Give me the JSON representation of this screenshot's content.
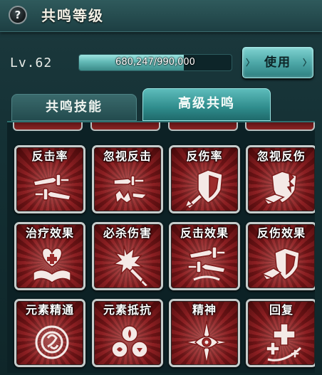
{
  "header": {
    "help_symbol": "?",
    "title": "共鸣等级"
  },
  "level": {
    "label": "Lv.62",
    "progress_text": "680,247/990,000",
    "progress_fraction": 0.687
  },
  "use_button": {
    "label": "使用",
    "left_arrow": "〉",
    "right_arrow": "〉"
  },
  "tabs": [
    {
      "label": "共鸣技能",
      "active": false
    },
    {
      "label": "高级共鸣",
      "active": true
    }
  ],
  "cards": [
    {
      "label": "反击率",
      "icon": "counter-rate-icon"
    },
    {
      "label": "忽视反击",
      "icon": "ignore-counter-icon"
    },
    {
      "label": "反伤率",
      "icon": "reflect-rate-icon"
    },
    {
      "label": "忽视反伤",
      "icon": "ignore-reflect-icon"
    },
    {
      "label": "治疗效果",
      "icon": "heal-effect-icon"
    },
    {
      "label": "必杀伤害",
      "icon": "crit-damage-icon"
    },
    {
      "label": "反击效果",
      "icon": "counter-effect-icon"
    },
    {
      "label": "反伤效果",
      "icon": "reflect-effect-icon"
    },
    {
      "label": "元素精通",
      "icon": "element-mastery-icon"
    },
    {
      "label": "元素抵抗",
      "icon": "element-resist-icon"
    },
    {
      "label": "精神",
      "icon": "spirit-icon"
    },
    {
      "label": "回复",
      "icon": "recovery-icon"
    }
  ]
}
